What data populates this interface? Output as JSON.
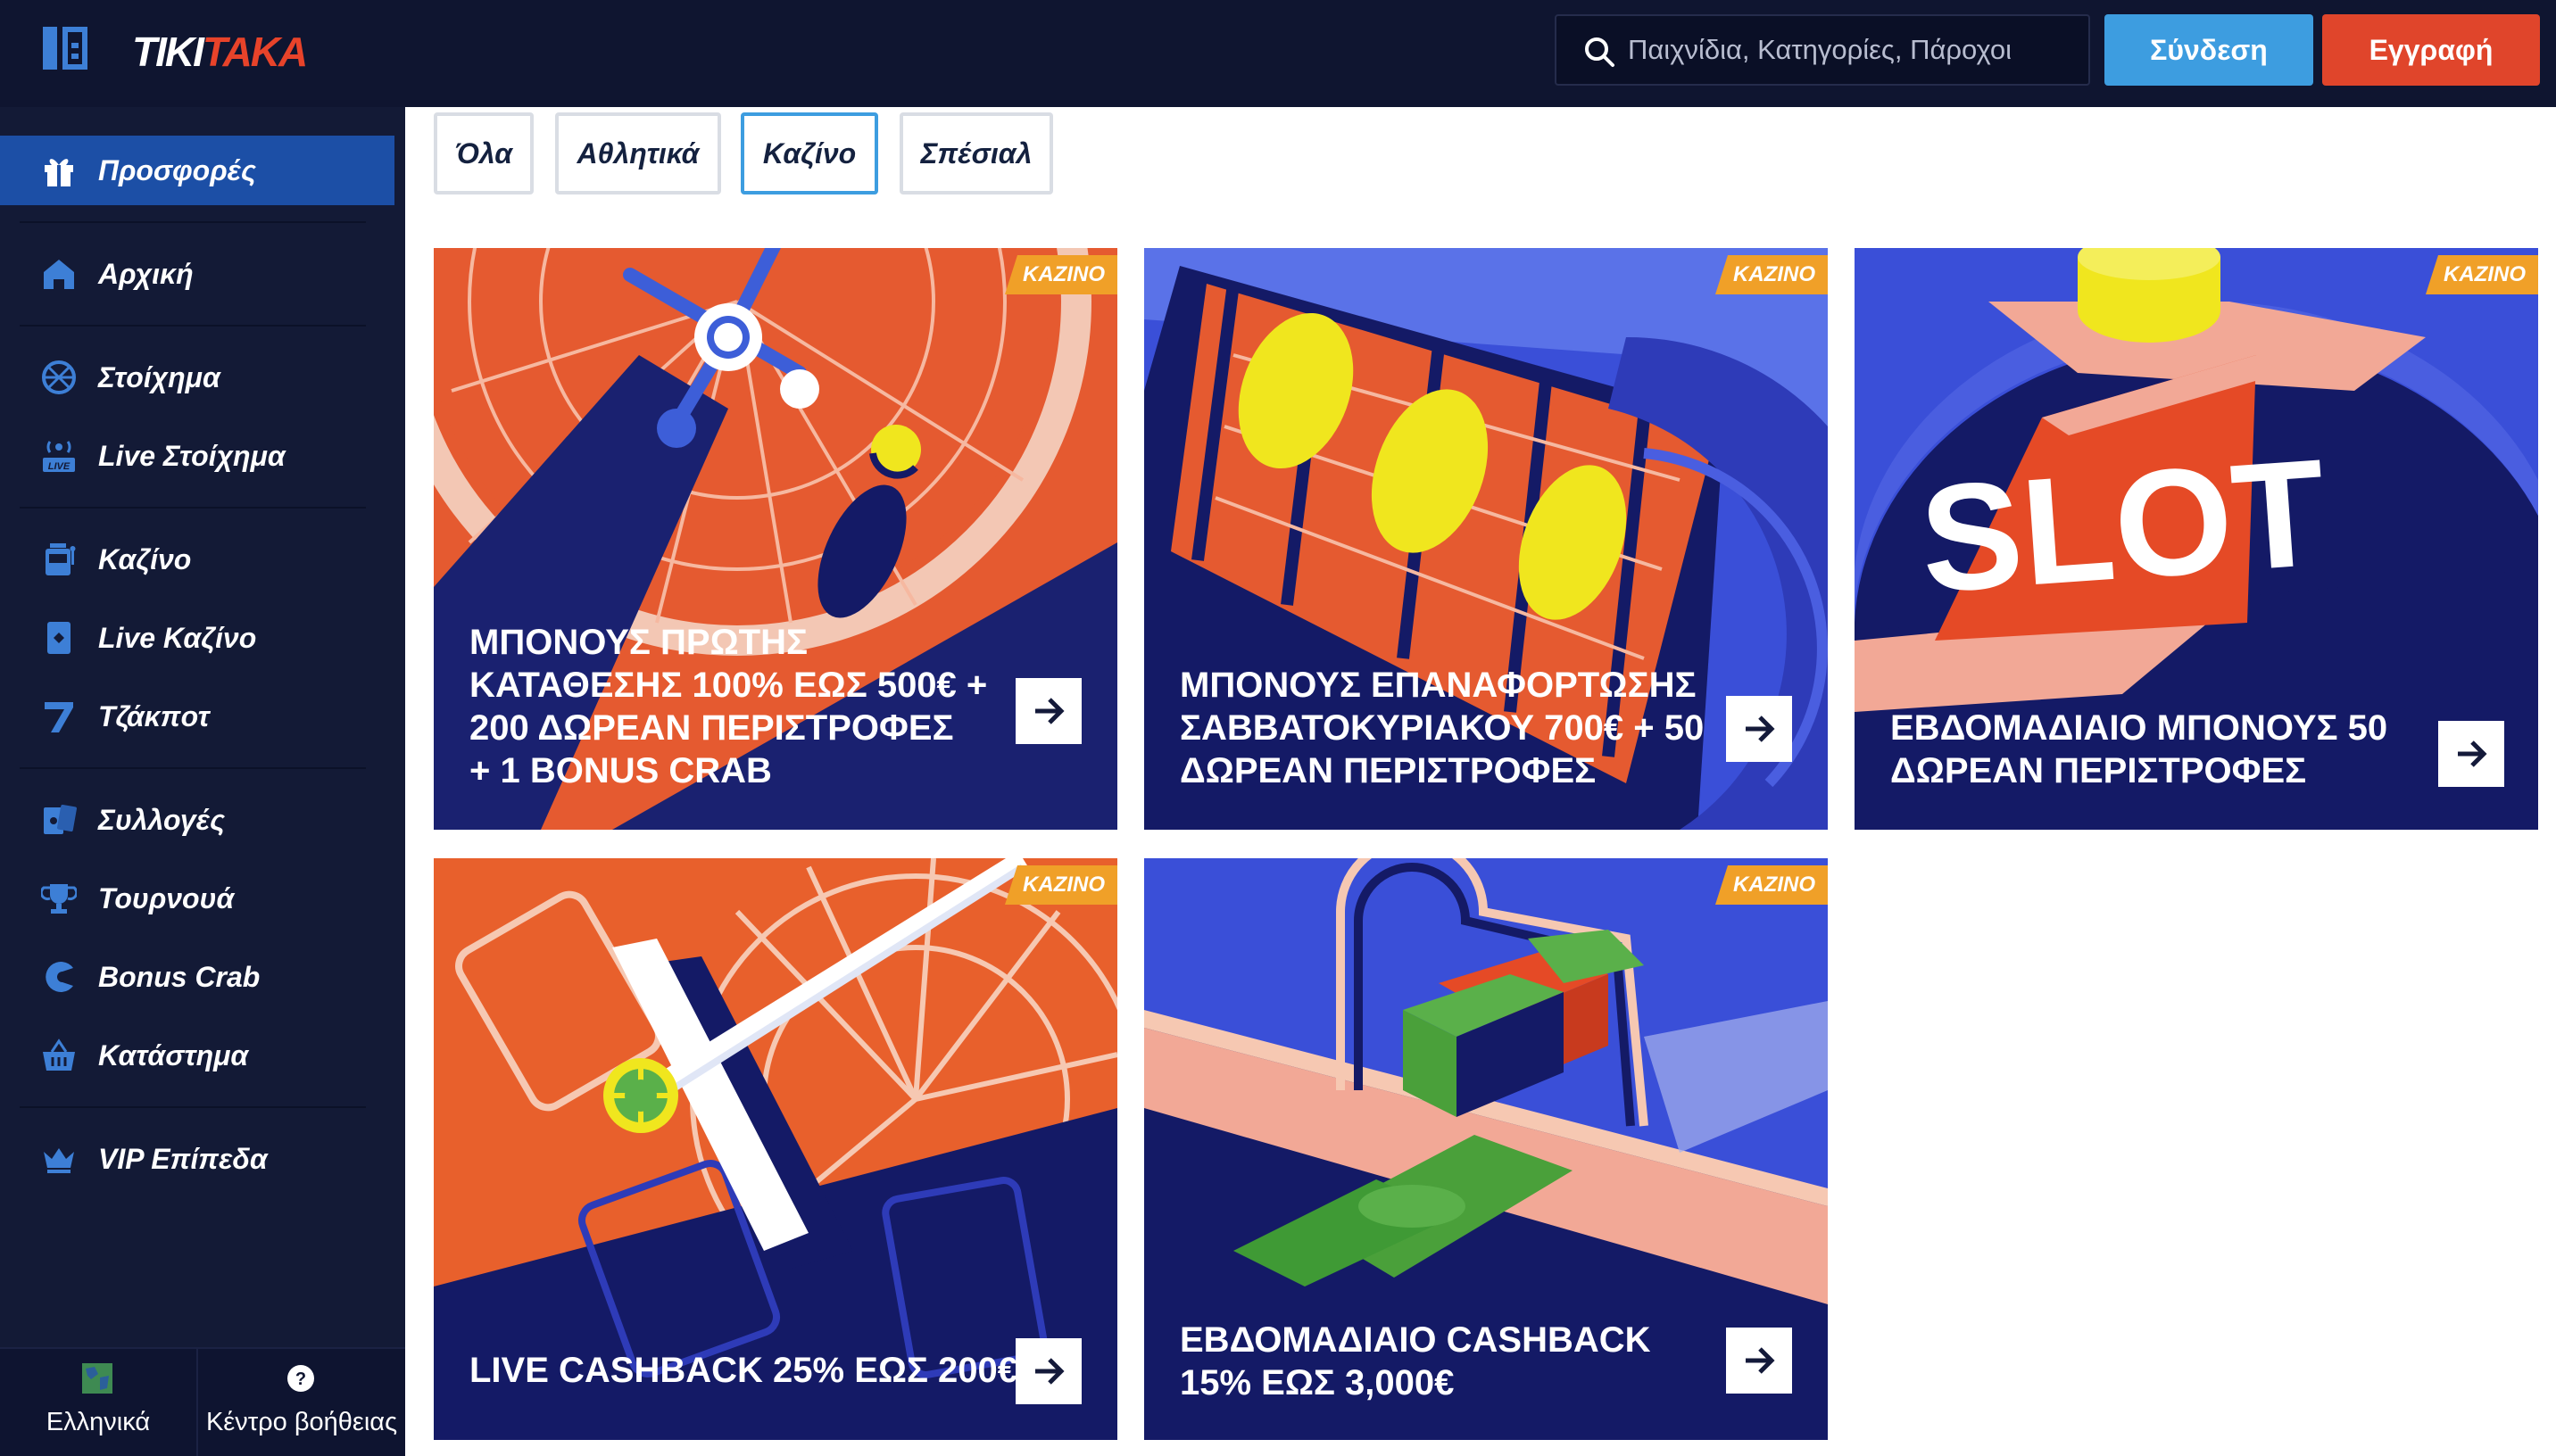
{
  "header": {
    "logo_white": "TIKI",
    "logo_red": "TAKA",
    "search_placeholder": "Παιχνίδια, Κατηγορίες, Πάροχοι",
    "login_label": "Σύνδεση",
    "register_label": "Εγγραφή"
  },
  "sidebar": {
    "items": [
      {
        "label": "Προσφορές",
        "icon": "gift-icon",
        "active": true
      },
      {
        "label": "Αρχική",
        "icon": "home-icon"
      },
      {
        "label": "Στοίχημα",
        "icon": "ball-icon"
      },
      {
        "label": "Live Στοίχημα",
        "icon": "live-broadcast-icon"
      },
      {
        "label": "Καζίνο",
        "icon": "slot-machine-icon"
      },
      {
        "label": "Live Καζίνο",
        "icon": "card-icon"
      },
      {
        "label": "Τζάκποτ",
        "icon": "seven-icon"
      },
      {
        "label": "Συλλογές",
        "icon": "cards-icon"
      },
      {
        "label": "Τουρνουά",
        "icon": "trophy-icon"
      },
      {
        "label": "Bonus Crab",
        "icon": "crab-icon"
      },
      {
        "label": "Κατάστημα",
        "icon": "basket-icon"
      },
      {
        "label": "VIP Επίπεδα",
        "icon": "crown-icon"
      }
    ],
    "footer": {
      "language_label": "Ελληνικά",
      "help_label": "Κέντρο βοήθειας"
    }
  },
  "filters": {
    "tabs": [
      "Όλα",
      "Αθλητικά",
      "Καζίνο",
      "Σπέσιαλ"
    ],
    "selected": "Καζίνο"
  },
  "promotions": [
    {
      "badge": "ΚΑΖΙΝΟ",
      "title_lines": [
        "ΜΠΟΝΟΥΣ ΠΡΩΤΗΣ",
        "ΚΑΤΑΘΕΣΗΣ 100% ΕΩΣ 500€ +",
        "200 ΔΩΡΕΑΝ ΠΕΡΙΣΤΡΟΦΕΣ",
        "+ 1 BONUS CRAB"
      ]
    },
    {
      "badge": "ΚΑΖΙΝΟ",
      "title_lines": [
        "ΜΠΟΝΟΥΣ ΕΠΑΝΑΦΟΡΤΩΣΗΣ",
        "ΣΑΒΒΑΤΟΚΥΡΙΑΚΟΥ 700€ + 50",
        "ΔΩΡΕΑΝ ΠΕΡΙΣΤΡΟΦΕΣ"
      ]
    },
    {
      "badge": "ΚΑΖΙΝΟ",
      "title_lines": [
        "ΕΒΔΟΜΑΔΙΑΙΟ ΜΠΟΝΟΥΣ 50",
        "ΔΩΡΕΑΝ ΠΕΡΙΣΤΡΟΦΕΣ"
      ],
      "art_text": "SLOT"
    },
    {
      "badge": "ΚΑΖΙΝΟ",
      "title_lines": [
        "LIVE CASHBACK 25% ΕΩΣ 200€"
      ]
    },
    {
      "badge": "ΚΑΖΙΝΟ",
      "title_lines": [
        "ΕΒΔΟΜΑΔΙΑΙΟ CASHBACK",
        "15% ΕΩΣ 3,000€"
      ]
    }
  ],
  "colors": {
    "header_bg": "#0f1530",
    "sidebar_bg": "#131a36",
    "active_nav": "#1c4fa6",
    "login_btn": "#3d9de0",
    "register_btn": "#e0452b",
    "badge": "#f0a028",
    "card_navy": "#141a66",
    "card_orange": "#e6602e"
  }
}
